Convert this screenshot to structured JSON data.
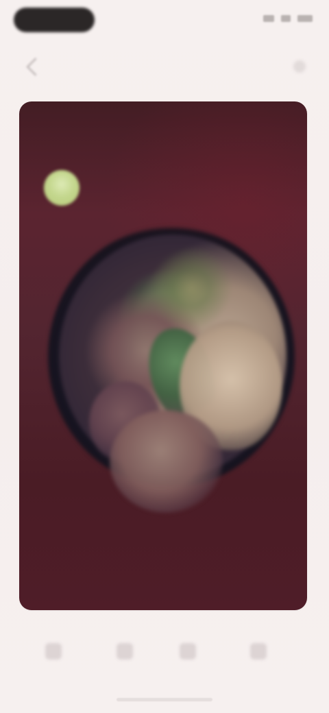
{
  "status_bar": {
    "icons": [
      "signal-icon",
      "wifi-icon",
      "battery-icon"
    ]
  },
  "navigation": {
    "title": "",
    "back_icon": "back-icon",
    "action_icon": "menu-icon"
  },
  "card": {
    "title": "",
    "author_name": "",
    "author_meta": "",
    "footer_primary": "",
    "footer_secondary": "",
    "stat_1": "",
    "stat_2": ""
  },
  "bottom_actions": [
    {
      "icon": "home-icon"
    },
    {
      "icon": "search-icon"
    },
    {
      "icon": "bookmark-icon"
    },
    {
      "icon": "profile-icon"
    }
  ],
  "colors": {
    "background": "#f6efee",
    "card": "#4f1d28",
    "accent": "#e8d7a5",
    "avatar": "#c4d78e"
  }
}
